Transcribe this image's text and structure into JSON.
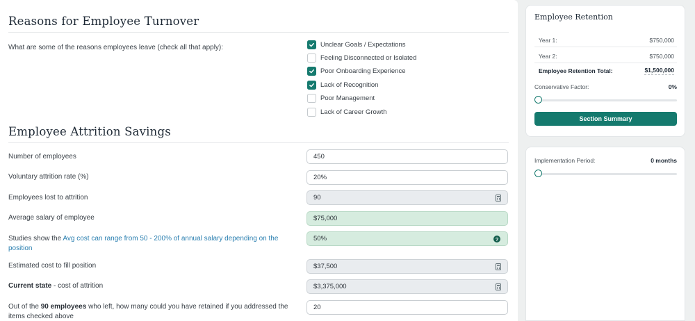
{
  "turnover": {
    "title": "Reasons for Employee Turnover",
    "question": "What are some of the reasons employees leave (check all that apply):",
    "reasons": [
      {
        "label": "Unclear Goals / Expectations",
        "checked": true
      },
      {
        "label": "Feeling Disconnected or Isolated",
        "checked": false
      },
      {
        "label": "Poor Onboarding Experience",
        "checked": true
      },
      {
        "label": "Lack of Recognition",
        "checked": true
      },
      {
        "label": "Poor Management",
        "checked": false
      },
      {
        "label": "Lack of Career Growth",
        "checked": false
      }
    ]
  },
  "savings": {
    "title": "Employee Attrition Savings",
    "rows": {
      "employees": {
        "label": "Number of employees",
        "value": "450"
      },
      "attrition_rate": {
        "label": "Voluntary attrition rate (%)",
        "value": "20%"
      },
      "lost": {
        "label": "Employees lost to attrition",
        "value": "90"
      },
      "salary": {
        "label": "Average salary of employee",
        "value": "$75,000"
      },
      "studies": {
        "prefix": "Studies show the ",
        "link": "Avg cost can range from 50 - 200% of annual salary depending on the position",
        "value": "50%",
        "help": "?"
      },
      "cost_fill": {
        "label": "Estimated cost to fill position",
        "value": "$37,500"
      },
      "current_state": {
        "bold": "Current state",
        "rest": " - cost of attrition",
        "value": "$3,375,000"
      },
      "retained": {
        "prefix": "Out of the ",
        "bold": "90 employees",
        "suffix": " who left, how many could you have retained if you addressed the items checked above",
        "value": "20"
      }
    }
  },
  "retention": {
    "title": "Employee Retention",
    "year1_label": "Year 1:",
    "year1_value": "$750,000",
    "year2_label": "Year 2:",
    "year2_value": "$750,000",
    "total_label": "Employee Retention Total:",
    "total_value": "$1,500,000",
    "conservative_label": "Conservative Factor:",
    "conservative_value": "0%",
    "conservative_level": 0,
    "summary_button": "Section Summary"
  },
  "implementation": {
    "label": "Implementation Period:",
    "value": "0 months",
    "level": 0
  },
  "colors": {
    "accent": "#157a6e",
    "green_field": "#d6ecdf",
    "gray_field": "#e9ecef",
    "link": "#2a7fb0"
  }
}
